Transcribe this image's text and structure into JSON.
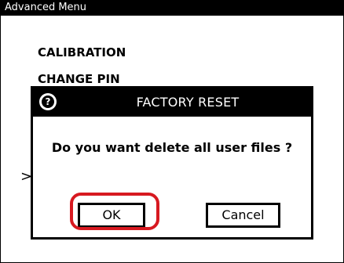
{
  "window": {
    "title": "Advanced Menu"
  },
  "menu": {
    "items": [
      {
        "label": "CALIBRATION"
      },
      {
        "label": "CHANGE PIN"
      }
    ],
    "cursor": ">"
  },
  "dialog": {
    "title": "FACTORY RESET",
    "icon": "question-icon",
    "message": "Do you want delete all user files ?",
    "ok_label": "OK",
    "cancel_label": "Cancel",
    "highlight_color": "#d71920"
  }
}
